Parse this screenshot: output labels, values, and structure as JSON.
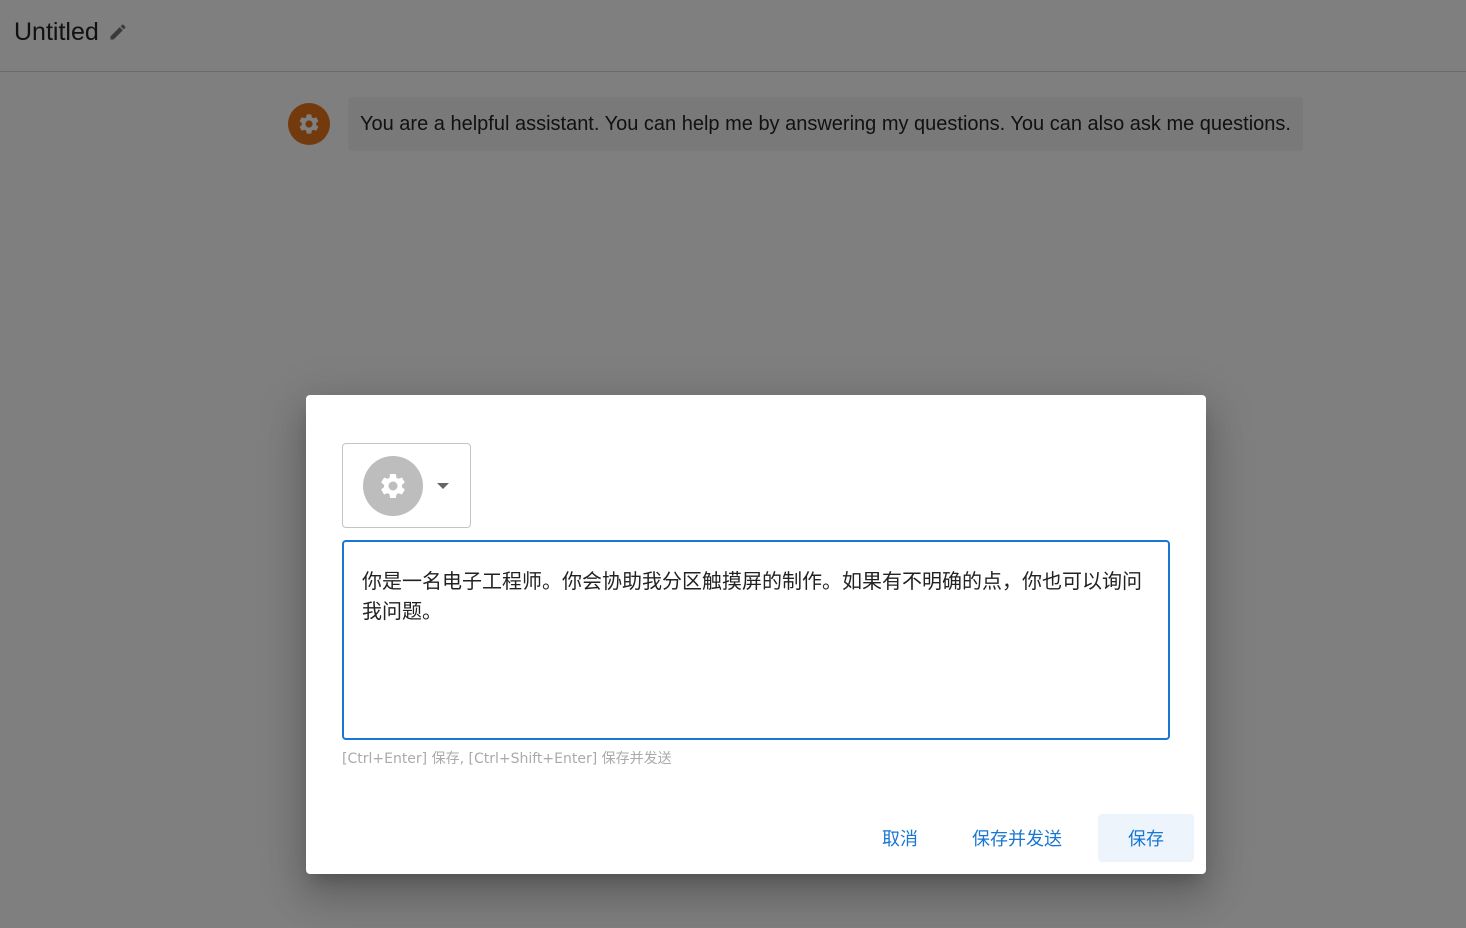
{
  "header": {
    "title": "Untitled"
  },
  "conversation": {
    "messages": [
      {
        "role_icon": "gear-icon",
        "text": "You are a helpful assistant. You can help me by answering my questions. You can also ask me questions."
      }
    ]
  },
  "dialog": {
    "role_icon": "gear-icon",
    "editor_value": "你是一名电子工程师。你会协助我分区触摸屏的制作。如果有不明确的点，你也可以询问我问题。",
    "hint": "[Ctrl+Enter] 保存, [Ctrl+Shift+Enter] 保存并发送",
    "buttons": {
      "cancel": "取消",
      "save_and_send": "保存并发送",
      "save": "保存"
    }
  },
  "colors": {
    "avatar_system": "#e6741a",
    "accent": "#1976d2",
    "overlay": "rgba(0,0,0,0.5)"
  }
}
